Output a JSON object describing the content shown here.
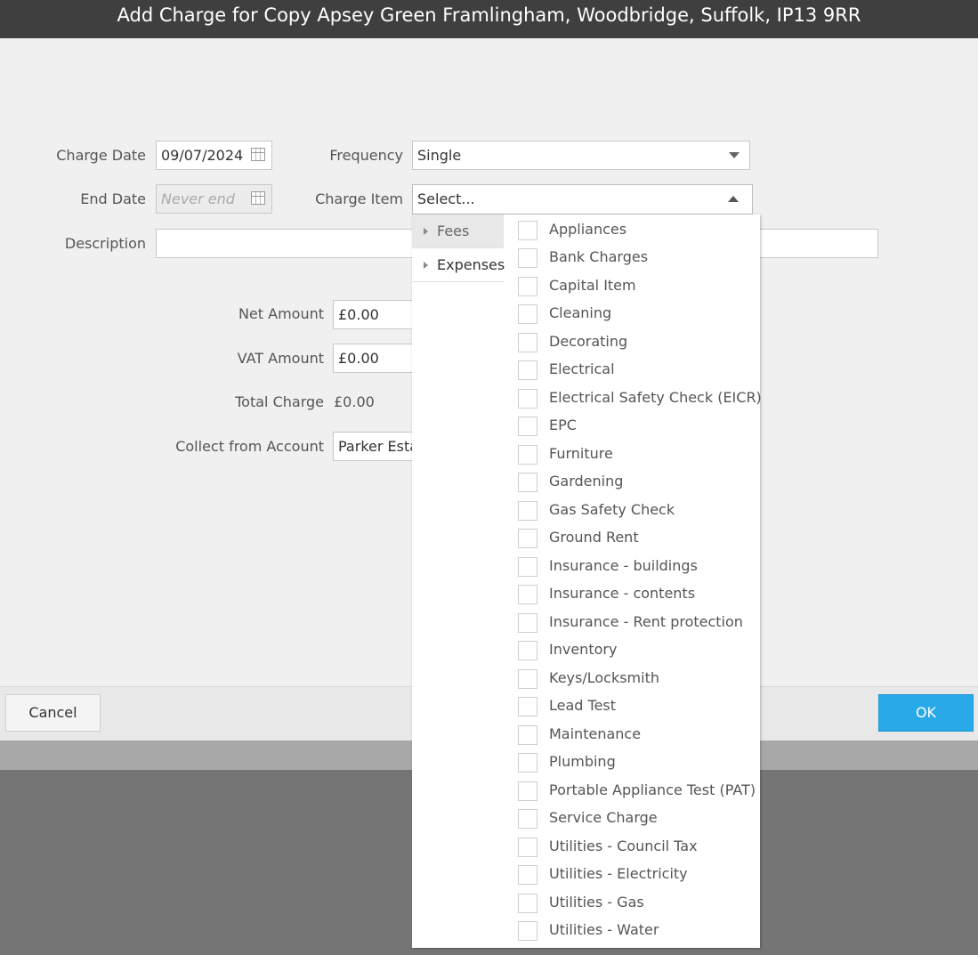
{
  "dialog": {
    "title": "Add Charge for Copy Apsey Green Framlingham, Woodbridge, Suffolk, IP13 9RR"
  },
  "form": {
    "charge_date_label": "Charge Date",
    "charge_date_value": "09/07/2024",
    "end_date_label": "End Date",
    "end_date_placeholder": "Never end",
    "frequency_label": "Frequency",
    "frequency_value": "Single",
    "charge_item_label": "Charge Item",
    "charge_item_value": "Select...",
    "description_label": "Description",
    "description_value": "",
    "net_amount_label": "Net Amount",
    "net_amount_value": "£0.00",
    "vat_amount_label": "VAT Amount",
    "vat_amount_value": "£0.00",
    "total_charge_label": "Total Charge",
    "total_charge_value": "£0.00",
    "collect_from_label": "Collect from Account",
    "collect_from_value": "Parker Estat"
  },
  "dropdown": {
    "categories": [
      {
        "label": "Fees",
        "active": true
      },
      {
        "label": "Expenses",
        "active": false
      }
    ],
    "items": [
      "Appliances",
      "Bank Charges",
      "Capital Item",
      "Cleaning",
      "Decorating",
      "Electrical",
      "Electrical Safety Check (EICR)",
      "EPC",
      "Furniture",
      "Gardening",
      "Gas Safety Check",
      "Ground Rent",
      "Insurance - buildings",
      "Insurance - contents",
      "Insurance - Rent protection",
      "Inventory",
      "Keys/Locksmith",
      "Lead Test",
      "Maintenance",
      "Plumbing",
      "Portable Appliance Test (PAT)",
      "Service Charge",
      "Utilities - Council Tax",
      "Utilities - Electricity",
      "Utilities - Gas",
      "Utilities - Water"
    ]
  },
  "buttons": {
    "cancel": "Cancel",
    "ok": "OK"
  },
  "colors": {
    "title_bar": "#3f3f3f",
    "ok_button": "#29a9e8",
    "overlay": "#757575"
  }
}
